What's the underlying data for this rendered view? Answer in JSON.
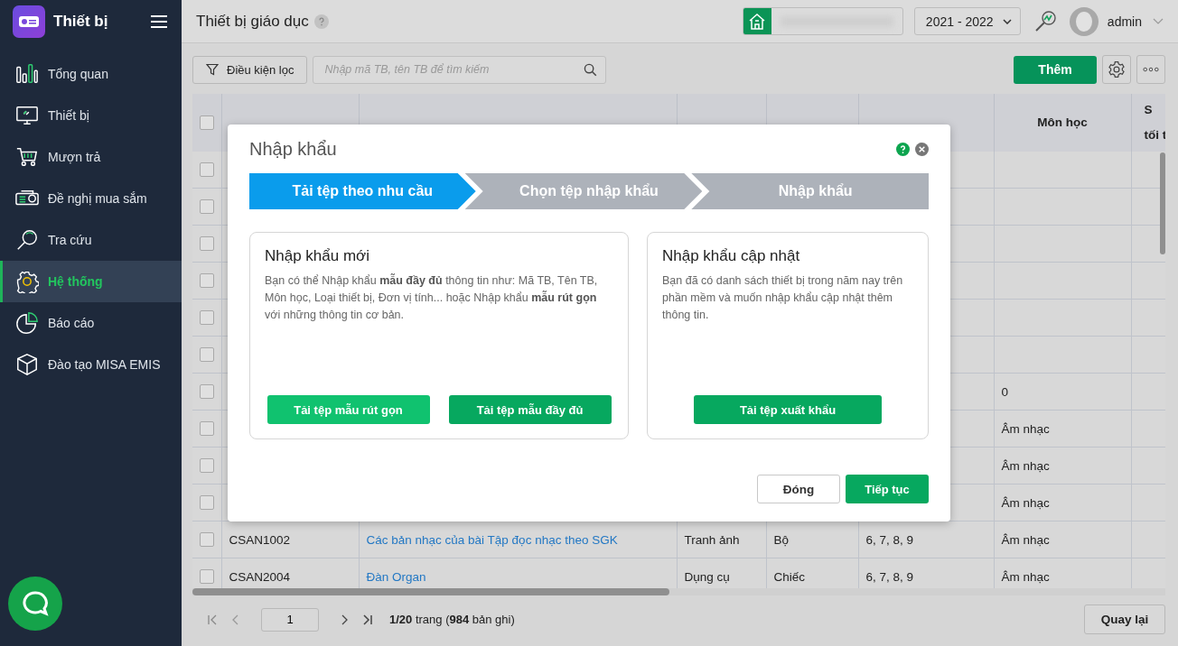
{
  "sidebar": {
    "app_title": "Thiết bị",
    "items": [
      {
        "label": "Tổng quan",
        "selected": false
      },
      {
        "label": "Thiết bị",
        "selected": false
      },
      {
        "label": "Mượn trả",
        "selected": false
      },
      {
        "label": "Đề nghị mua sắm",
        "selected": false
      },
      {
        "label": "Tra cứu",
        "selected": false
      },
      {
        "label": "Hệ thống",
        "selected": true
      },
      {
        "label": "Báo cáo",
        "selected": false
      },
      {
        "label": "Đào tạo MISA EMIS",
        "selected": false
      }
    ]
  },
  "header": {
    "title": "Thiết bị giáo dục",
    "school_year": "2021 - 2022",
    "user": "admin"
  },
  "toolbar": {
    "filter_button": "Điều kiện lọc",
    "search": {
      "placeholder": "Nhập mã TB, tên TB để tìm kiếm"
    },
    "add_button": "Thêm"
  },
  "table": {
    "all_checked": false,
    "columns": [
      {
        "lines": [
          "Môn học"
        ]
      },
      {
        "lines": [
          "S",
          "tối t"
        ]
      }
    ],
    "rows": [
      {
        "checked": false
      },
      {
        "checked": false
      },
      {
        "checked": false
      },
      {
        "checked": false
      },
      {
        "checked": false
      },
      {
        "checked": false
      },
      {
        "checked": false,
        "subject": "0"
      },
      {
        "checked": false,
        "subject": "Âm nhạc"
      },
      {
        "checked": false,
        "subject": "Âm nhạc"
      },
      {
        "checked": false,
        "subject": "Âm nhạc"
      },
      {
        "checked": false,
        "code": "CSAN1002",
        "name": "Các bản nhạc của bài Tập đọc nhạc theo SGK",
        "type": "Tranh ảnh",
        "unit": "Bộ",
        "grades": "6, 7, 8, 9",
        "subject": "Âm nhạc"
      },
      {
        "checked": false,
        "code": "CSAN2004",
        "name": "Đàn Organ",
        "type": "Dụng cụ",
        "unit": "Chiếc",
        "grades": "6, 7, 8, 9",
        "subject": "Âm nhạc"
      }
    ]
  },
  "pagination": {
    "page": "1",
    "summary": "**1/20** trang (**984** bản ghi)",
    "back_button": "Quay lại"
  },
  "dialog": {
    "title": "Nhập khẩu",
    "steps": [
      {
        "label": "Tải tệp theo nhu cầu",
        "selected": true
      },
      {
        "label": "Chọn tệp nhập khẩu",
        "selected": false
      },
      {
        "label": "Nhập khẩu",
        "selected": false
      }
    ],
    "cards": [
      {
        "title": "Nhập khẩu mới",
        "description": "Bạn có thể Nhập khẩu **mẫu đầy đủ** thông tin như: Mã TB, Tên TB, Môn học, Loại thiết bị, Đơn vị tính... hoặc Nhập khẩu **mẫu rút gọn** với những thông tin cơ bản.",
        "buttons": [
          {
            "label": "Tải tệp mẫu rút gọn",
            "kind": "light"
          },
          {
            "label": "Tải tệp mẫu đầy đủ",
            "kind": "primary"
          }
        ]
      },
      {
        "title": "Nhập khẩu cập nhật",
        "description": "Bạn đã có danh sách thiết bị trong năm nay trên phần mềm và muốn nhập khẩu cập nhật thêm thông tin.",
        "buttons": [
          {
            "label": "Tải tệp xuất khẩu",
            "kind": "primary"
          }
        ]
      }
    ],
    "footer_buttons": [
      {
        "label": "Đóng",
        "kind": "secondary"
      },
      {
        "label": "Tiếp tục",
        "kind": "primary"
      }
    ]
  }
}
